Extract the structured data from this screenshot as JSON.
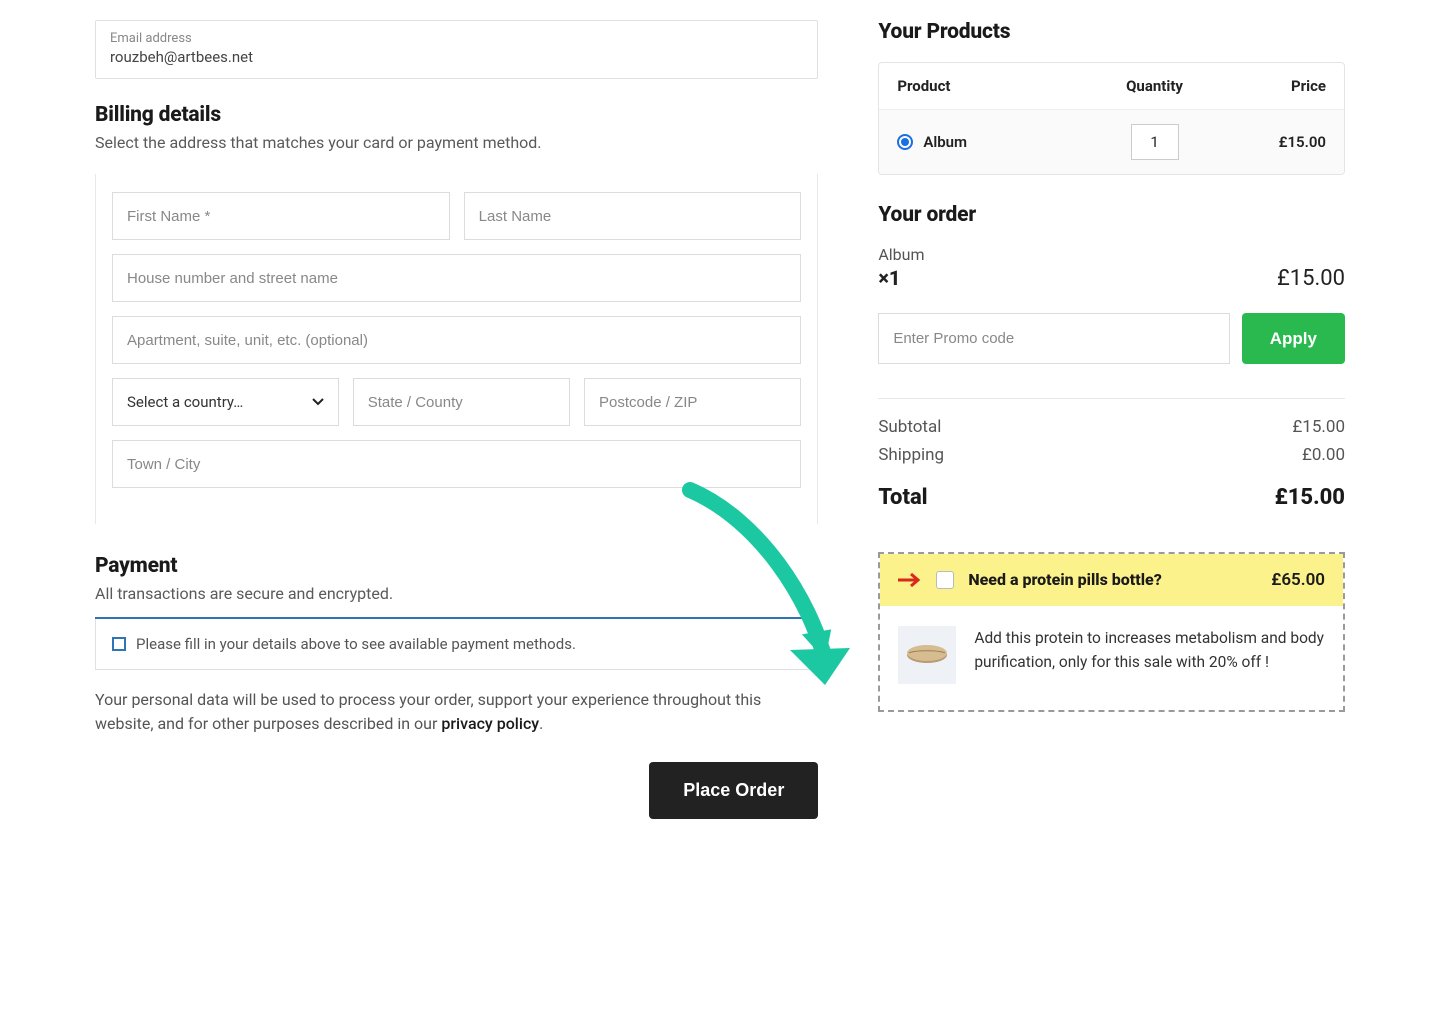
{
  "email": {
    "label": "Email address",
    "value": "rouzbeh@artbees.net"
  },
  "billing": {
    "title": "Billing details",
    "subtitle": "Select the address that matches your card or payment method.",
    "first_name_ph": "First Name *",
    "last_name_ph": "Last Name",
    "street_ph": "House number and street name",
    "apt_ph": "Apartment, suite, unit, etc. (optional)",
    "country_ph": "Select a country…",
    "state_ph": "State / County",
    "postcode_ph": "Postcode / ZIP",
    "city_ph": "Town / City"
  },
  "payment": {
    "title": "Payment",
    "subtitle": "All transactions are secure and encrypted.",
    "notice": "Please fill in your details above to see available payment methods.",
    "privacy_text_a": "Your personal data will be used to process your order, support your experience throughout this website, and for other purposes described in our ",
    "privacy_link": "privacy policy",
    "privacy_text_b": ".",
    "place_order": "Place Order"
  },
  "products": {
    "title": "Your Products",
    "col_product": "Product",
    "col_qty": "Quantity",
    "col_price": "Price",
    "items": [
      {
        "name": "Album",
        "qty": "1",
        "price": "£15.00",
        "selected": true
      }
    ]
  },
  "order": {
    "title": "Your order",
    "line_name": "Album",
    "line_qty": "×1",
    "line_price": "£15.00",
    "promo_ph": "Enter Promo code",
    "apply": "Apply",
    "subtotal_label": "Subtotal",
    "subtotal": "£15.00",
    "shipping_label": "Shipping",
    "shipping": "£0.00",
    "total_label": "Total",
    "total": "£15.00"
  },
  "upsell": {
    "title": "Need a protein pills bottle?",
    "price": "£65.00",
    "desc": "Add this protein to increases metabolism and body purification, only for this sale with 20% off !"
  }
}
